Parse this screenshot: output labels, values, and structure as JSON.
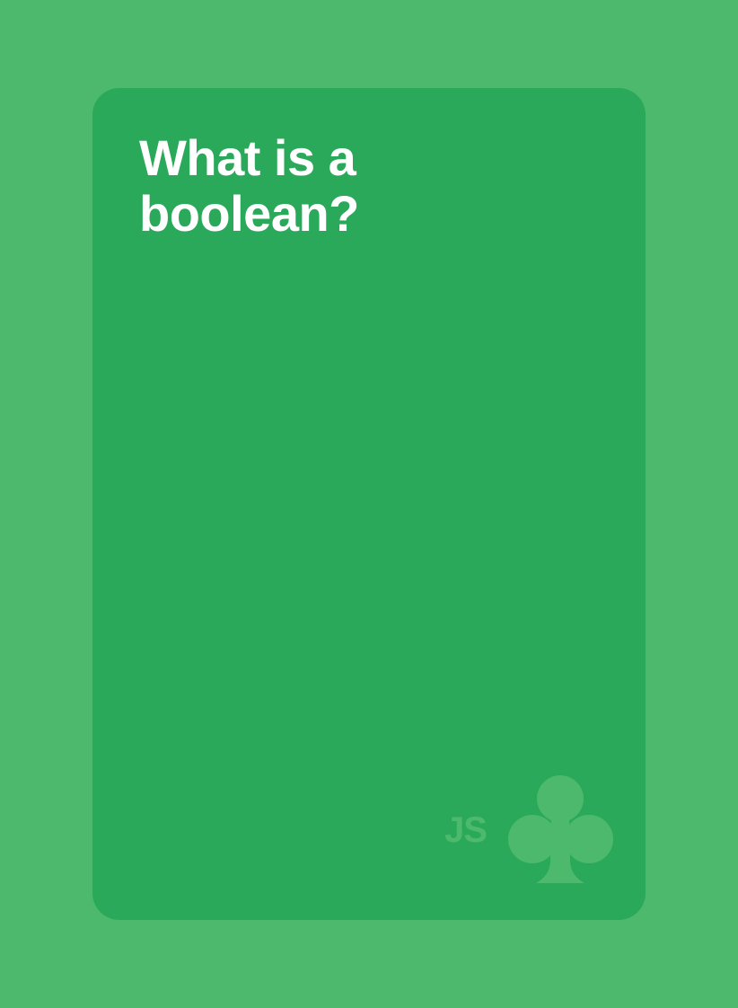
{
  "card": {
    "question": "What is a boolean?",
    "brand_label": "JS",
    "suit_icon": "club-icon"
  },
  "colors": {
    "background": "#4cb96c",
    "card": "#2aa95b",
    "text": "#ffffff",
    "mark": "#4cb96c"
  }
}
